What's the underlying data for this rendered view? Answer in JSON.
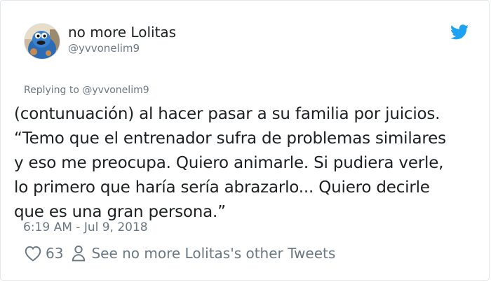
{
  "user": {
    "display_name": "no more Lolitas",
    "handle": "@yvvonelim9"
  },
  "reply": {
    "prefix": "Replying to ",
    "mention": "@yvvonelim9"
  },
  "tweet": {
    "lines": [
      "(contunuación) al hacer pasar a su familia por juicios.",
      "“Temo que el entrenador sufra de problemas similares",
      "y eso me preocupa. Quiero animarle. Si pudiera verle,",
      "lo primero que haría sería abrazarlo... Quiero decirle",
      "que es una gran persona.”"
    ],
    "timestamp": "6:19 AM - Jul 9, 2018"
  },
  "actions": {
    "like_count": "63",
    "other_tweets": "See no more Lolitas's other Tweets"
  },
  "icons": {
    "bird": "twitter-bird-icon",
    "heart": "heart-icon",
    "person": "person-icon"
  },
  "colors": {
    "twitter_blue": "#1da1f2",
    "text": "#1c2022",
    "muted": "#697882",
    "border": "#e1e8ed"
  }
}
